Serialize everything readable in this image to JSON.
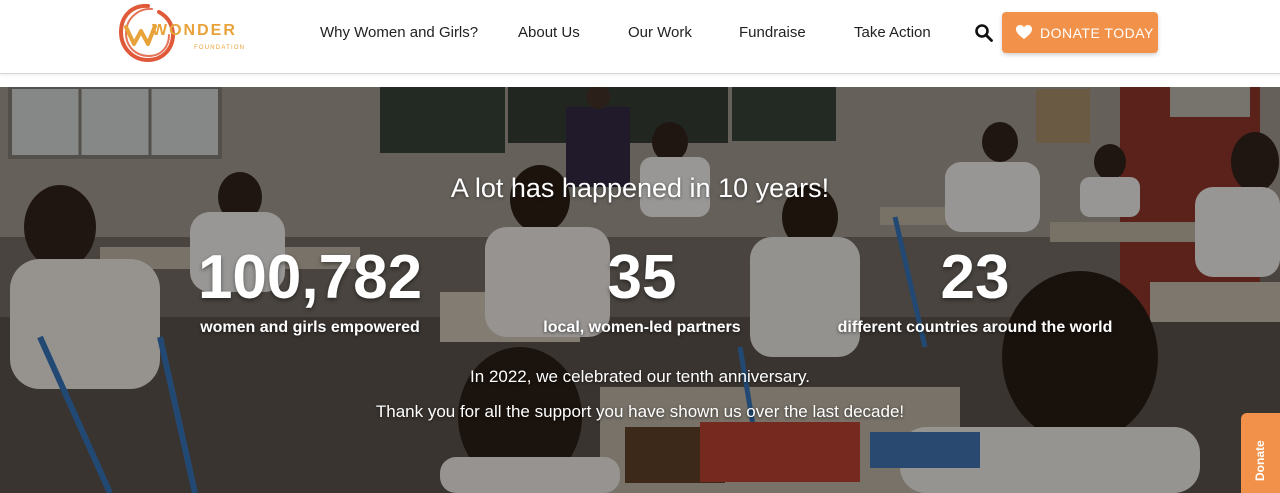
{
  "brand": {
    "wordmark": "WONDER",
    "subline": "FOUNDATION",
    "accent_color": "#f2924a",
    "logo_color": "#e8a23a",
    "logo_ring_color": "#e05a3a"
  },
  "nav": {
    "items": [
      {
        "label": "Why Women and Girls?"
      },
      {
        "label": "About Us"
      },
      {
        "label": "Our Work"
      },
      {
        "label": "Fundraise"
      },
      {
        "label": "Take Action"
      }
    ],
    "search_icon": "search-icon",
    "donate_label": "DONATE TODAY",
    "donate_icon": "heart-icon"
  },
  "hero": {
    "title": "A lot has happened in 10 years!",
    "stats": [
      {
        "value": "100,782",
        "label": "women and girls empowered"
      },
      {
        "value": "35",
        "label": "local, women-led partners"
      },
      {
        "value": "23",
        "label": "different countries around the world"
      }
    ],
    "line_1": "In 2022, we celebrated our tenth anniversary.",
    "line_2": "Thank you for all the support you have shown us over the last decade!"
  },
  "side_tab": {
    "label": "Donate"
  }
}
